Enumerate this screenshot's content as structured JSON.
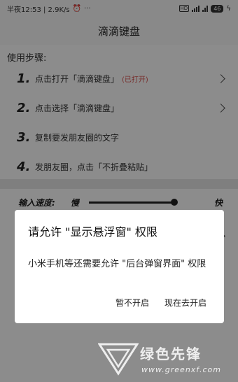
{
  "status_bar": {
    "time_info": "半夜12:53 | 2.9K/s",
    "hd_label": "HD",
    "battery": "46"
  },
  "title": "滴滴键盘",
  "steps_title": "使用步骤:",
  "steps": [
    {
      "num": "1.",
      "text": "点击打开「滴滴键盘」",
      "note": "(已打开)"
    },
    {
      "num": "2.",
      "text": "点击选择「滴滴键盘」",
      "note": ""
    },
    {
      "num": "3.",
      "text": "复制要发朋友圈的文字",
      "note": ""
    },
    {
      "num": "4.",
      "text": "发朋友圈，点击「不折叠粘贴」",
      "note": ""
    }
  ],
  "speed": {
    "label": "输入速度:",
    "slow": "慢",
    "fast": "快",
    "level": 1.0
  },
  "dialog": {
    "title": "请允许 \"显示悬浮窗\" 权限",
    "body": "小米手机等还需要允许 \"后台弹窗界面\" 权限",
    "deny": "暂不开启",
    "allow": "现在去开启"
  },
  "watermark": {
    "name": "绿色先锋",
    "url": "www.greenxf.com"
  },
  "colors": {
    "note_red": "#d9534f"
  }
}
